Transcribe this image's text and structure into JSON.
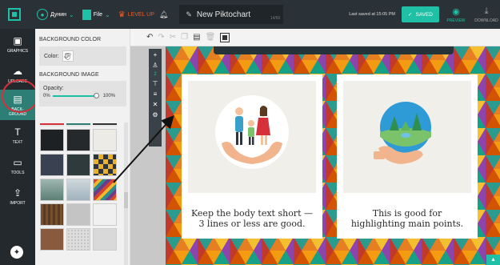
{
  "topbar": {
    "user_name": "Дунин",
    "file_label": "File",
    "levelup_label": "LEVEL UP",
    "doc_title": "New Piktochart",
    "title_count": "14/60",
    "last_saved": "Last saved at 15:05 PM",
    "saved_label": "SAVED",
    "preview_label": "PREVIEW",
    "download_label": "DOWNLOAD"
  },
  "rail": {
    "items": [
      {
        "label": "GRAPHICS",
        "icon": "image-icon"
      },
      {
        "label": "UPLOADS",
        "icon": "cloud-icon"
      },
      {
        "label": "BACK-",
        "label2": "GROUND",
        "icon": "background-icon"
      },
      {
        "label": "TEXT",
        "icon": "text-icon"
      },
      {
        "label": "TOOLS",
        "icon": "toolbox-icon"
      },
      {
        "label": "IMPORT",
        "icon": "import-icon"
      }
    ]
  },
  "panel": {
    "bg_color_title": "BACKGROUND COLOR",
    "color_label": "Color:",
    "bg_image_title": "BACKGROUND IMAGE",
    "opacity_label": "Opacity:",
    "opacity_min": "0%",
    "opacity_max": "100%",
    "opacity_value": 1.0
  },
  "vtool": {
    "number": "2"
  },
  "cards": [
    {
      "line1": "Keep the body text short —",
      "line2": "3 lines or less are good."
    },
    {
      "line1": "This is good for",
      "line2": "highlighting main points."
    }
  ],
  "colors": {
    "accent": "#1fc0a5",
    "topbar": "#2b3237",
    "rail": "#23292d",
    "levelup": "#f05a28",
    "annotation": "#d6303a"
  }
}
